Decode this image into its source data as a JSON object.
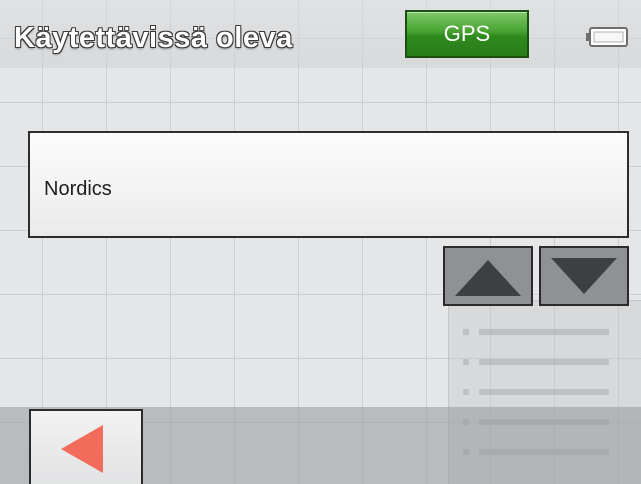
{
  "header": {
    "title": "Käytettävissä oleva",
    "gps_label": "GPS",
    "battery_icon": "battery-icon"
  },
  "list": {
    "items": [
      {
        "label": "Nordics"
      }
    ]
  },
  "scroll": {
    "up_icon": "up-arrow-icon",
    "down_icon": "down-arrow-icon"
  },
  "footer": {
    "back_icon": "back-arrow-icon"
  },
  "colors": {
    "gps_green": "#3c9a28",
    "back_arrow": "#f26c5c",
    "arrow_dark": "#3d3f42"
  }
}
